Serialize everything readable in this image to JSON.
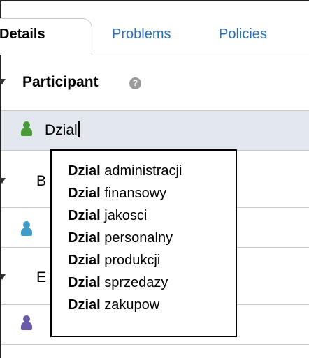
{
  "tabs": [
    {
      "label": "Details"
    },
    {
      "label": "Problems"
    },
    {
      "label": "Policies"
    }
  ],
  "participant_section": {
    "title": "Participant",
    "help": "?",
    "input_value": "Dzial"
  },
  "section_b": {
    "title": "B"
  },
  "section_e": {
    "title": "E"
  },
  "dropdown": {
    "query": "Dzial",
    "options": [
      {
        "match": "Dzial",
        "rest": " administracji"
      },
      {
        "match": "Dzial",
        "rest": " finansowy"
      },
      {
        "match": "Dzial",
        "rest": " jakosci"
      },
      {
        "match": "Dzial",
        "rest": " personalny"
      },
      {
        "match": "Dzial",
        "rest": " produkcji"
      },
      {
        "match": "Dzial",
        "rest": " sprzedazy"
      },
      {
        "match": "Dzial",
        "rest": " zakupow"
      }
    ]
  },
  "colors": {
    "link": "#2a6fb5",
    "icon_green": "#4a9a3a",
    "icon_blue": "#3f9cc8",
    "icon_purple": "#6a5aa8",
    "selected_row": "#e3e8ee"
  }
}
